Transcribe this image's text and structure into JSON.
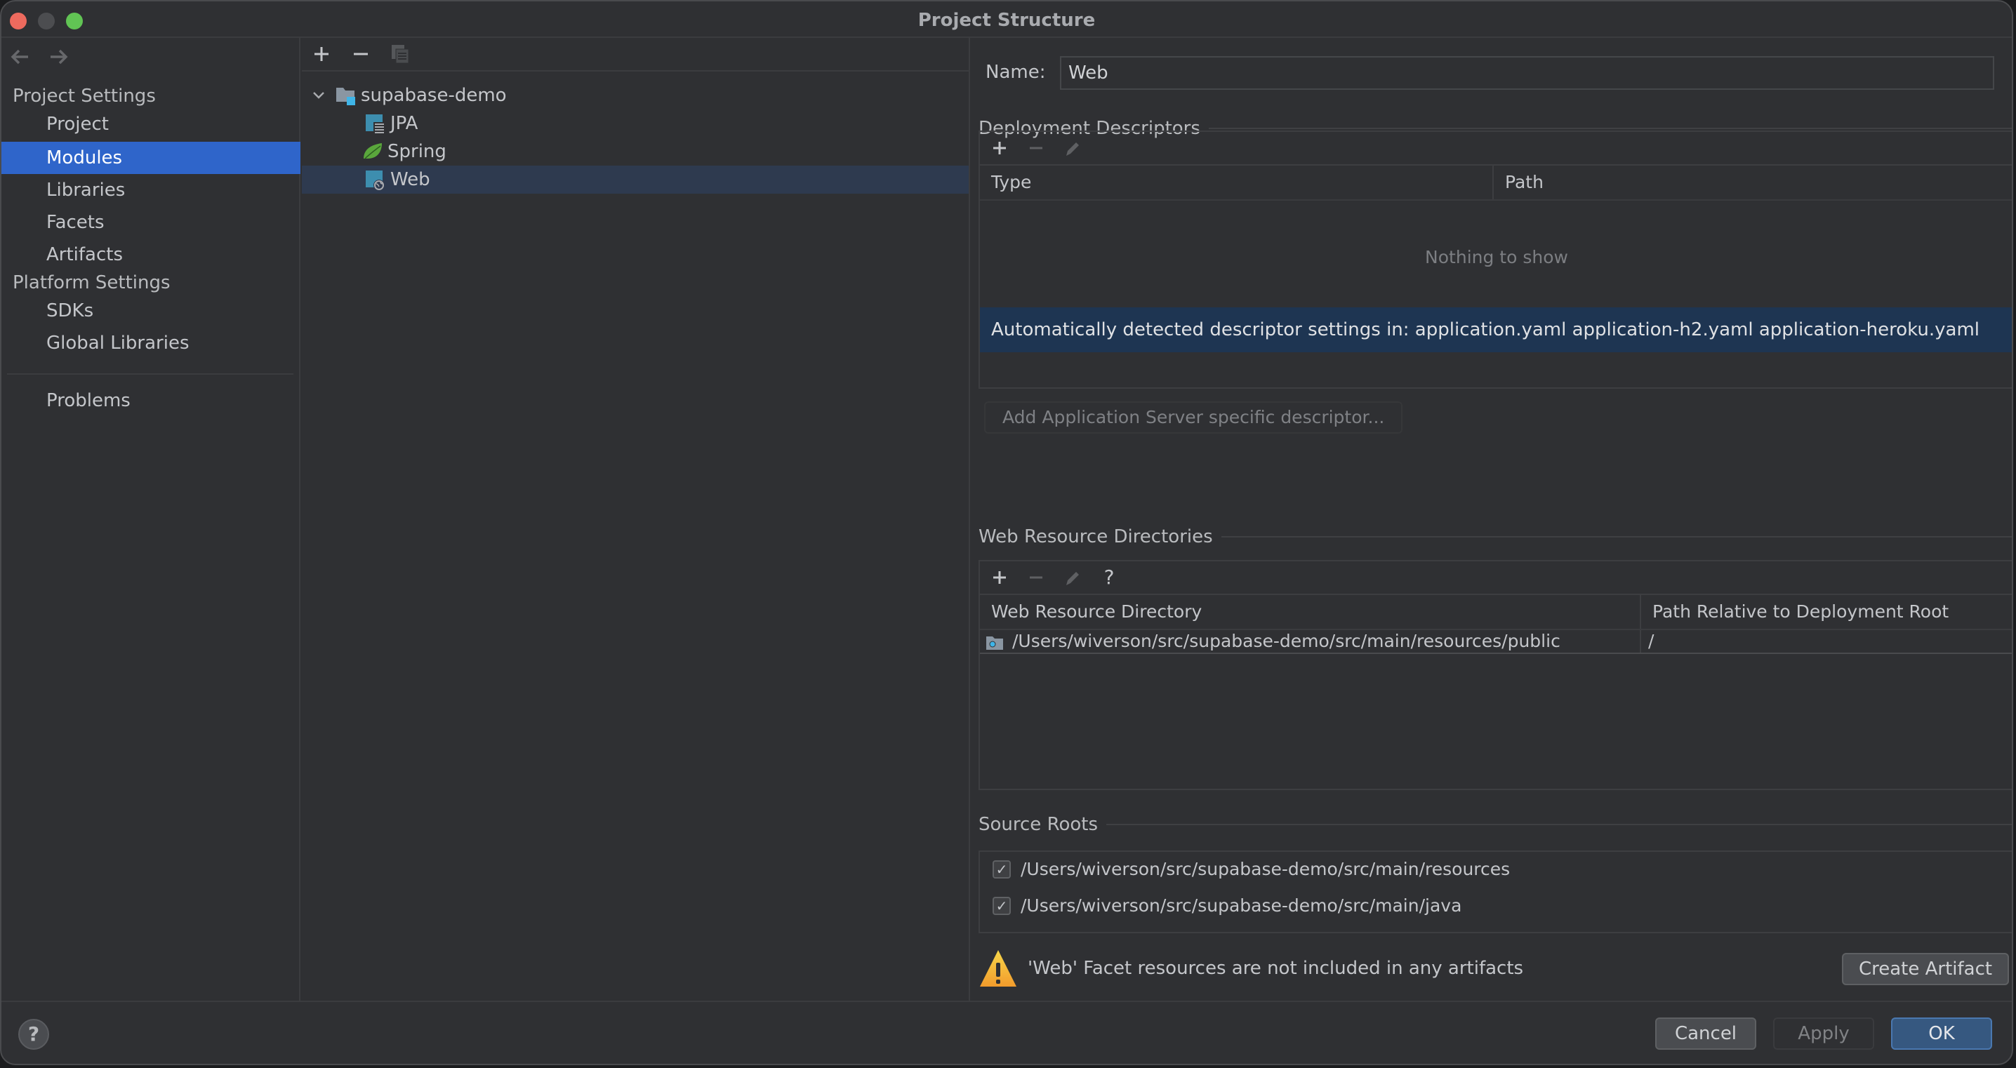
{
  "window": {
    "title": "Project Structure"
  },
  "nav": {
    "back_icon": "arrow-left-icon",
    "forward_icon": "arrow-right-icon"
  },
  "sidebar": {
    "project_settings_label": "Project Settings",
    "project_items": [
      {
        "label": "Project",
        "selected": false
      },
      {
        "label": "Modules",
        "selected": true
      },
      {
        "label": "Libraries",
        "selected": false
      },
      {
        "label": "Facets",
        "selected": false
      },
      {
        "label": "Artifacts",
        "selected": false
      }
    ],
    "platform_settings_label": "Platform Settings",
    "platform_items": [
      {
        "label": "SDKs"
      },
      {
        "label": "Global Libraries"
      }
    ],
    "problems_label": "Problems"
  },
  "tree": {
    "toolbar": {
      "add_icon": "plus-icon",
      "remove_icon": "minus-icon",
      "copy_icon": "copy-icon"
    },
    "root": {
      "label": "supabase-demo",
      "expanded": true,
      "icon": "module-folder-icon"
    },
    "children": [
      {
        "label": "JPA",
        "icon": "jpa-facet-icon"
      },
      {
        "label": "Spring",
        "icon": "spring-leaf-icon"
      },
      {
        "label": "Web",
        "icon": "web-facet-icon",
        "selected": true
      }
    ]
  },
  "detail": {
    "name_label": "Name:",
    "name_value": "Web",
    "deployment_descriptors": {
      "title": "Deployment Descriptors",
      "columns": [
        "Type",
        "Path"
      ],
      "empty_text": "Nothing to show",
      "detected_message": "Automatically detected descriptor settings in: application.yaml application-h2.yaml application-heroku.yaml",
      "add_server_descriptor_label": "Add Application Server specific descriptor..."
    },
    "web_resource_directories": {
      "title": "Web Resource Directories",
      "help_label": "?",
      "columns": [
        "Web Resource Directory",
        "Path Relative to Deployment Root"
      ],
      "rows": [
        {
          "directory": "/Users/wiverson/src/supabase-demo/src/main/resources/public",
          "relative_path": "/"
        }
      ]
    },
    "source_roots": {
      "title": "Source Roots",
      "items": [
        {
          "path": "/Users/wiverson/src/supabase-demo/src/main/resources",
          "checked": true
        },
        {
          "path": "/Users/wiverson/src/supabase-demo/src/main/java",
          "checked": true
        }
      ]
    },
    "warning": {
      "message": "'Web' Facet resources are not included in any artifacts",
      "action_label": "Create Artifact"
    }
  },
  "footer": {
    "help_label": "?",
    "cancel_label": "Cancel",
    "apply_label": "Apply",
    "ok_label": "OK"
  },
  "colors": {
    "selection_blue": "#2f65ca",
    "tree_selection": "#2e3a4f",
    "detected_row": "#1e3552",
    "ok_button": "#365880",
    "background": "#2f3033"
  }
}
